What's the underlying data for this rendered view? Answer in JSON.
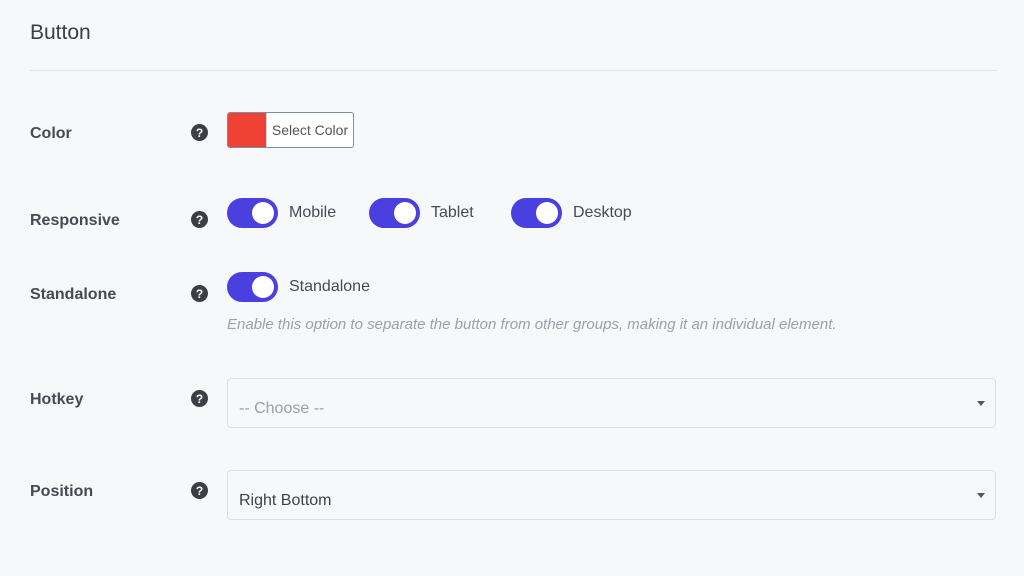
{
  "section": {
    "title": "Button"
  },
  "help_glyph": "?",
  "color": {
    "label": "Color",
    "button_label": "Select Color",
    "swatch": "#ef4136"
  },
  "responsive": {
    "label": "Responsive",
    "toggles": [
      {
        "label": "Mobile",
        "on": true
      },
      {
        "label": "Tablet",
        "on": true
      },
      {
        "label": "Desktop",
        "on": true
      }
    ]
  },
  "standalone": {
    "label": "Standalone",
    "toggle_label": "Standalone",
    "on": true,
    "hint": "Enable this option to separate the button from other groups, making it an individual element."
  },
  "hotkey": {
    "label": "Hotkey",
    "placeholder": "-- Choose --"
  },
  "position": {
    "label": "Position",
    "value": "Right Bottom"
  },
  "colors": {
    "toggle_on": "#4a3fdf",
    "help_icon_bg": "#3a3f47"
  }
}
